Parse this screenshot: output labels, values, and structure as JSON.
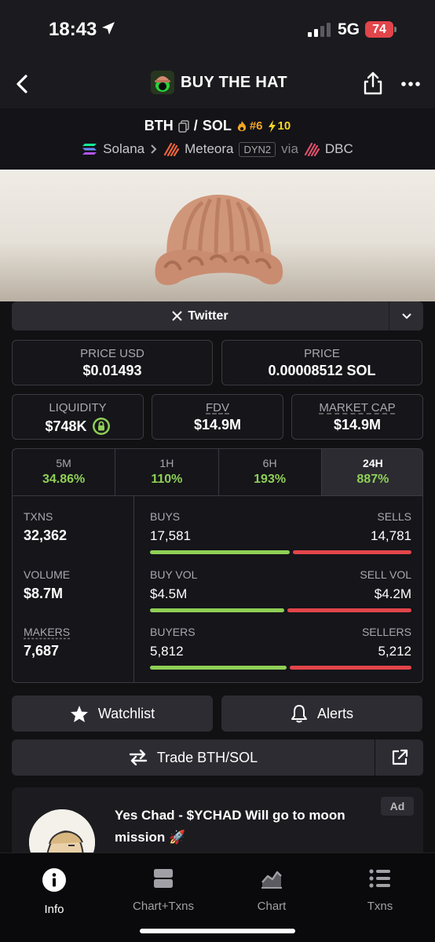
{
  "status_bar": {
    "time": "18:43",
    "network": "5G",
    "battery": "74"
  },
  "nav": {
    "title": "BUY THE HAT",
    "logo_icon": "hat-token-logo"
  },
  "pair": {
    "base": "BTH",
    "separator": "/",
    "quote": "SOL",
    "rank": "#6",
    "boosts": "10",
    "chain": "Solana",
    "dex": "Meteora",
    "dex_badge": "DYN2",
    "via_label": "via",
    "launchpad": "DBC"
  },
  "social": {
    "twitter_label": "Twitter"
  },
  "prices": {
    "price_usd_label": "PRICE USD",
    "price_usd": "$0.01493",
    "price_label": "PRICE",
    "price_native": "0.00008512 SOL"
  },
  "metrics": {
    "liquidity_label": "LIQUIDITY",
    "liquidity": "$748K",
    "fdv_label": "FDV",
    "fdv": "$14.9M",
    "mcap_label": "MARKET CAP",
    "mcap": "$14.9M"
  },
  "timeframes": [
    {
      "label": "5M",
      "change": "34.86%"
    },
    {
      "label": "1H",
      "change": "110%"
    },
    {
      "label": "6H",
      "change": "193%"
    },
    {
      "label": "24H",
      "change": "887%",
      "active": true
    }
  ],
  "stats": {
    "txns_label": "TXNS",
    "txns": "32,362",
    "volume_label": "VOLUME",
    "volume": "$8.7M",
    "makers_label": "MAKERS",
    "makers": "7,687",
    "buys_label": "BUYS",
    "buys": "17,581",
    "sells_label": "SELLS",
    "sells": "14,781",
    "buys_ratio": 0.54,
    "buy_vol_label": "BUY VOL",
    "buy_vol": "$4.5M",
    "sell_vol_label": "SELL VOL",
    "sell_vol": "$4.2M",
    "buy_vol_ratio": 0.52,
    "buyers_label": "BUYERS",
    "buyers": "5,812",
    "sellers_label": "SELLERS",
    "sellers": "5,212",
    "buyers_ratio": 0.53
  },
  "actions": {
    "watchlist": "Watchlist",
    "alerts": "Alerts",
    "trade": "Trade BTH/SOL"
  },
  "ad": {
    "text": "Yes Chad - $YCHAD Will go to moon mission 🚀",
    "badge": "Ad"
  },
  "tab_bar": [
    {
      "label": "Info",
      "icon": "info-icon",
      "active": true
    },
    {
      "label": "Chart+Txns",
      "icon": "split-view-icon"
    },
    {
      "label": "Chart",
      "icon": "area-chart-icon"
    },
    {
      "label": "Txns",
      "icon": "list-icon"
    }
  ],
  "colors": {
    "positive": "#8fcf56",
    "negative": "#e2454a",
    "rank": "#f5a524"
  }
}
